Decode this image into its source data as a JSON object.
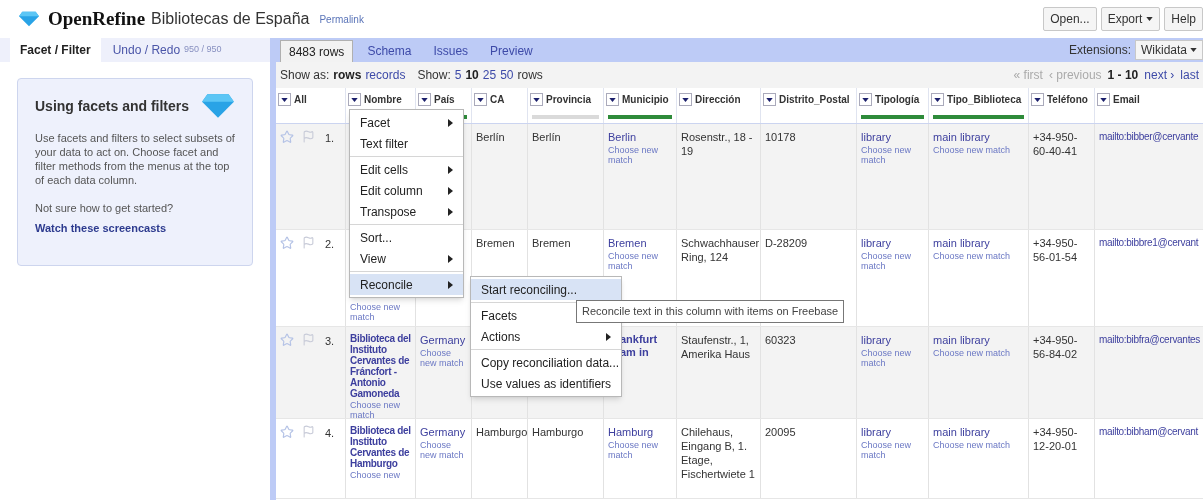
{
  "header": {
    "logo_text": "OpenRefine",
    "project": "Bibliotecas de España",
    "permalink": "Permalink",
    "buttons": [
      {
        "label": "Open...",
        "caret": false
      },
      {
        "label": "Export",
        "caret": true
      },
      {
        "label": "Help",
        "caret": false
      }
    ]
  },
  "left_tabs": [
    {
      "label": "Facet / Filter",
      "selected": true
    },
    {
      "label": "Undo / Redo",
      "count": "950 / 950",
      "selected": false
    }
  ],
  "help_card": {
    "title": "Using facets and filters",
    "body": "Use facets and filters to select subsets of your data to act on. Choose facet and filter methods from the menus at the top of each data column.",
    "prompt": "Not sure how to get started?",
    "link": "Watch these screencasts"
  },
  "view_tabs": [
    {
      "label": "8483 rows",
      "selected": true
    },
    {
      "label": "Schema",
      "selected": false
    },
    {
      "label": "Issues",
      "selected": false
    },
    {
      "label": "Preview",
      "selected": false
    }
  ],
  "extensions": {
    "label": "Extensions:",
    "value": "Wikidata"
  },
  "show_as": {
    "label": "Show as:",
    "options": [
      {
        "label": "rows",
        "selected": true
      },
      {
        "label": "records",
        "selected": false
      }
    ]
  },
  "show": {
    "label": "Show:",
    "options": [
      {
        "label": "5",
        "selected": false
      },
      {
        "label": "10",
        "selected": true
      },
      {
        "label": "25",
        "selected": false
      },
      {
        "label": "50",
        "selected": false
      }
    ],
    "suffix": "rows"
  },
  "pager": [
    {
      "label": "« first",
      "kind": "disabled"
    },
    {
      "label": "‹ previous",
      "kind": "disabled"
    },
    {
      "label": "1 - 10",
      "kind": "current"
    },
    {
      "label": "next ›",
      "kind": "link"
    },
    {
      "label": "last",
      "kind": "link"
    }
  ],
  "table": {
    "columns": [
      {
        "label": "All"
      },
      {
        "label": "Nombre"
      },
      {
        "label": "País",
        "matched": true
      },
      {
        "label": "CA"
      },
      {
        "label": "Provincia",
        "matched": false
      },
      {
        "label": "Municipio",
        "matched": true
      },
      {
        "label": "Dirección"
      },
      {
        "label": "Distrito_Postal"
      },
      {
        "label": "Tipología",
        "matched": true
      },
      {
        "label": "Tipo_Biblioteca",
        "matched": true
      },
      {
        "label": "Teléfono"
      },
      {
        "label": "Email"
      }
    ],
    "rows": [
      {
        "number": "1.",
        "starred": false,
        "flagged": false,
        "cells": {
          "ca": {
            "text": "Berlín",
            "kind": "plain"
          },
          "provincia": {
            "text": "Berlín",
            "kind": "plain"
          },
          "municipio": {
            "text": "Berlin",
            "match": "Choose new match",
            "kind": "match"
          },
          "direccion": {
            "text": "Rosenstr., 18 - 19",
            "kind": "plain"
          },
          "distrito_postal": {
            "text": "10178",
            "kind": "plain"
          },
          "tipologia": {
            "text": "library",
            "match": "Choose new match",
            "kind": "match"
          },
          "tipo_biblioteca": {
            "text": "main library",
            "match": "Choose new match",
            "kind": "match"
          },
          "telefono": {
            "text": "+34-950-60-40-41",
            "kind": "plain"
          },
          "email": {
            "text": "mailto:bibber@cervante",
            "kind": "email"
          }
        }
      },
      {
        "number": "2.",
        "starred": false,
        "flagged": false,
        "cells": {
          "nombre": {
            "match": "Choose new match",
            "kind": "name"
          },
          "ca": {
            "text": "Bremen",
            "kind": "plain"
          },
          "provincia": {
            "text": "Bremen",
            "kind": "plain"
          },
          "municipio": {
            "text": "Bremen",
            "match": "Choose new match",
            "kind": "match"
          },
          "direccion": {
            "text": "Schwachhauser Ring, 124",
            "kind": "plain"
          },
          "distrito_postal": {
            "text": "D-28209",
            "kind": "plain"
          },
          "tipologia": {
            "text": "library",
            "match": "Choose new match",
            "kind": "match"
          },
          "tipo_biblioteca": {
            "text": "main library",
            "match": "Choose new match",
            "kind": "match"
          },
          "telefono": {
            "text": "+34-950-56-01-54",
            "kind": "plain"
          },
          "email": {
            "text": "mailto:bibbre1@cervant",
            "kind": "email"
          }
        }
      },
      {
        "number": "3.",
        "starred": false,
        "flagged": false,
        "cells": {
          "nombre": {
            "text": "Biblioteca del Instituto Cervantes de Fráncfort - Antonio Gamoneda",
            "match": "Choose new match",
            "kind": "name"
          },
          "pais": {
            "text": "Germany",
            "match": "Choose new match",
            "kind": "match"
          },
          "municipio": {
            "text": "ankfurt am in",
            "kind": "clipped"
          },
          "direccion": {
            "text": "Staufenstr., 1, Amerika Haus",
            "kind": "plain"
          },
          "distrito_postal": {
            "text": "60323",
            "kind": "plain"
          },
          "tipologia": {
            "text": "library",
            "match": "Choose new match",
            "kind": "match"
          },
          "tipo_biblioteca": {
            "text": "main library",
            "match": "Choose new match",
            "kind": "match"
          },
          "telefono": {
            "text": "+34-950-56-84-02",
            "kind": "plain"
          },
          "email": {
            "text": "mailto:bibfra@cervantes",
            "kind": "email"
          }
        }
      },
      {
        "number": "4.",
        "starred": false,
        "flagged": false,
        "cells": {
          "nombre": {
            "text": "Biblioteca del Instituto Cervantes de Hamburgo",
            "match": "Choose new",
            "kind": "name"
          },
          "pais": {
            "text": "Germany",
            "match": "Choose new match",
            "kind": "match"
          },
          "ca": {
            "text": "Hamburgo",
            "kind": "plain"
          },
          "provincia": {
            "text": "Hamburgo",
            "kind": "plain"
          },
          "municipio": {
            "text": "Hamburg",
            "match": "Choose new match",
            "kind": "match"
          },
          "direccion": {
            "text": "Chilehaus, Eingang B, 1. Etage, Fischertwiete 1",
            "kind": "plain"
          },
          "distrito_postal": {
            "text": "20095",
            "kind": "plain"
          },
          "tipologia": {
            "text": "library",
            "match": "Choose new match",
            "kind": "match"
          },
          "tipo_biblioteca": {
            "text": "main library",
            "match": "Choose new match",
            "kind": "match"
          },
          "telefono": {
            "text": "+34-950-12-20-01",
            "kind": "plain"
          },
          "email": {
            "text": "mailto:bibham@cervant",
            "kind": "email"
          }
        }
      }
    ]
  },
  "column_menu": [
    {
      "kind": "item",
      "label": "Facet",
      "submenu": true,
      "selected": false
    },
    {
      "kind": "item",
      "label": "Text filter",
      "submenu": false,
      "selected": false
    },
    {
      "kind": "separator"
    },
    {
      "kind": "item",
      "label": "Edit cells",
      "submenu": true,
      "selected": false
    },
    {
      "kind": "item",
      "label": "Edit column",
      "submenu": true,
      "selected": false
    },
    {
      "kind": "item",
      "label": "Transpose",
      "submenu": true,
      "selected": false
    },
    {
      "kind": "separator"
    },
    {
      "kind": "item",
      "label": "Sort...",
      "submenu": false,
      "selected": false
    },
    {
      "kind": "item",
      "label": "View",
      "submenu": true,
      "selected": false
    },
    {
      "kind": "separator"
    },
    {
      "kind": "item",
      "label": "Reconcile",
      "submenu": true,
      "selected": true
    }
  ],
  "reconcile_menu": [
    {
      "kind": "item",
      "label": "Start reconciling...",
      "submenu": false,
      "selected": true
    },
    {
      "kind": "separator"
    },
    {
      "kind": "item",
      "label": "Facets",
      "submenu": false,
      "selected": false
    },
    {
      "kind": "item",
      "label": "Actions",
      "submenu": true,
      "selected": false
    },
    {
      "kind": "separator"
    },
    {
      "kind": "item",
      "label": "Copy reconciliation data...",
      "submenu": false,
      "selected": false
    },
    {
      "kind": "item",
      "label": "Use values as identifiers",
      "submenu": false,
      "selected": false
    }
  ],
  "tooltip": "Reconcile text in this column with items on Freebase"
}
